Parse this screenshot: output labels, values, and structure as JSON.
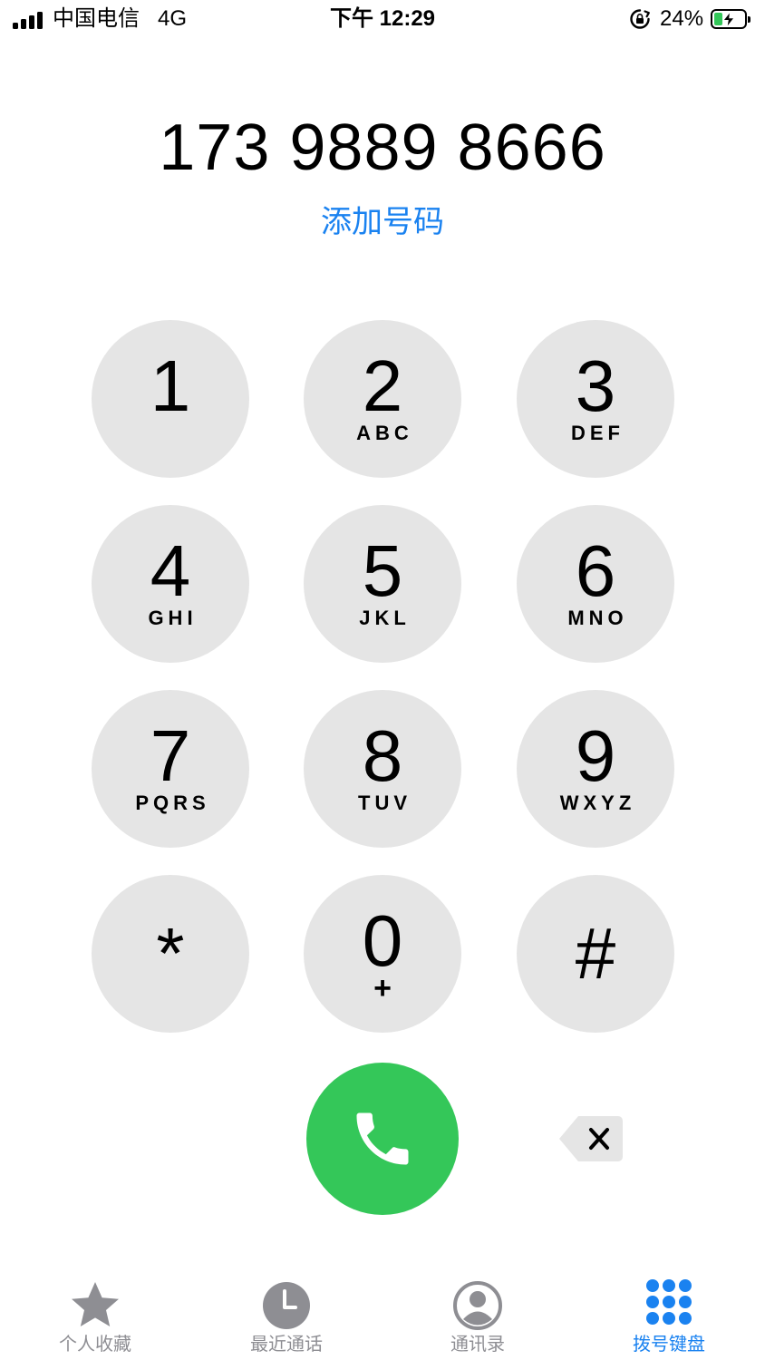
{
  "status_bar": {
    "carrier": "中国电信",
    "network": "4G",
    "time": "下午 12:29",
    "battery": "24%",
    "battery_level": 0.24,
    "icons": [
      "signal-icon",
      "rotation-lock-icon",
      "battery-icon",
      "charging-bolt-icon"
    ]
  },
  "dialer": {
    "number": "173 9889 8666",
    "add_number": "添加号码"
  },
  "keypad": {
    "keys": [
      {
        "digit": "1",
        "letters": ""
      },
      {
        "digit": "2",
        "letters": "ABC"
      },
      {
        "digit": "3",
        "letters": "DEF"
      },
      {
        "digit": "4",
        "letters": "GHI"
      },
      {
        "digit": "5",
        "letters": "JKL"
      },
      {
        "digit": "6",
        "letters": "MNO"
      },
      {
        "digit": "7",
        "letters": "PQRS"
      },
      {
        "digit": "8",
        "letters": "TUV"
      },
      {
        "digit": "9",
        "letters": "WXYZ"
      },
      {
        "digit": "*",
        "letters": ""
      },
      {
        "digit": "0",
        "letters": "+"
      },
      {
        "digit": "#",
        "letters": ""
      }
    ]
  },
  "actions": {
    "call_icon": "phone-icon",
    "delete_icon": "backspace-icon"
  },
  "tabs": [
    {
      "label": "个人收藏",
      "icon": "star-icon",
      "active": false
    },
    {
      "label": "最近通话",
      "icon": "clock-icon",
      "active": false
    },
    {
      "label": "通讯录",
      "icon": "contact-icon",
      "active": false
    },
    {
      "label": "拨号键盘",
      "icon": "keypad-icon",
      "active": true
    }
  ],
  "colors": {
    "accent": "#1a82f0",
    "call_green": "#34c759",
    "key_bg": "#e5e5e5",
    "inactive_tab": "#8e8e93"
  }
}
